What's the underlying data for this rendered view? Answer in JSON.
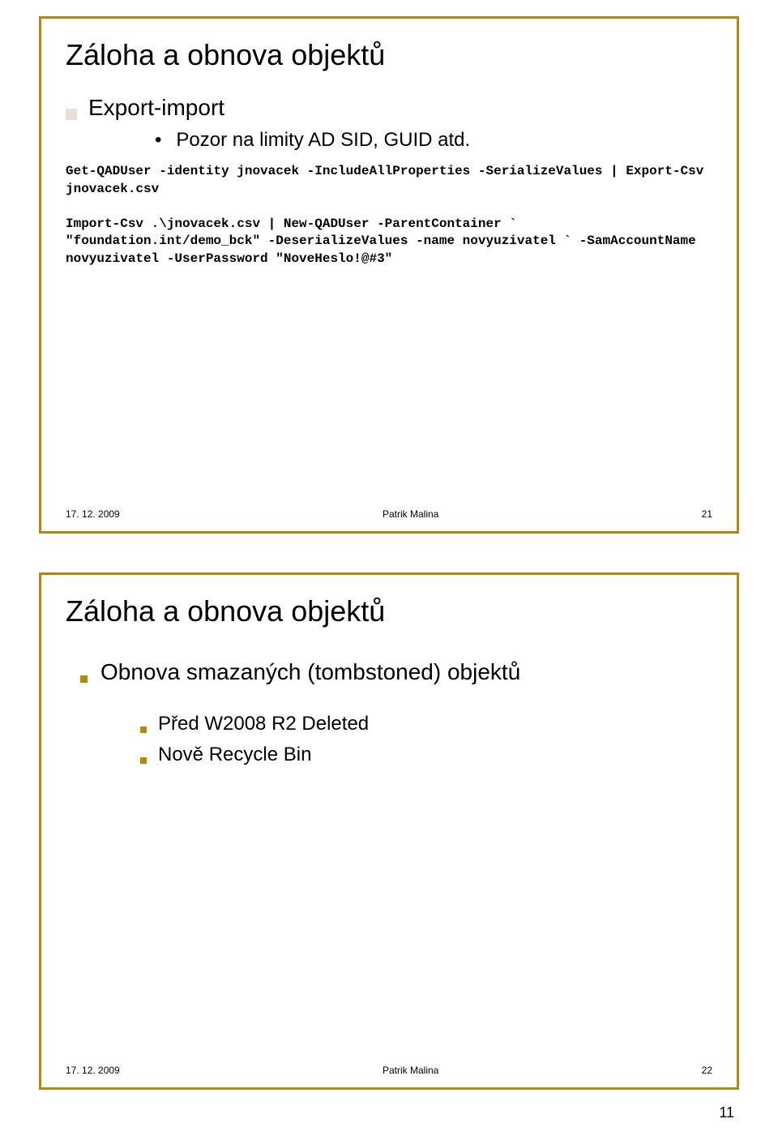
{
  "slide1": {
    "title": "Záloha a obnova objektů",
    "bullet": "Export-import",
    "subbullet": "Pozor na limity AD SID, GUID atd.",
    "code": "Get-QADUser -identity jnovacek -IncludeAllProperties -SerializeValues | Export-Csv jnovacek.csv\n\nImport-Csv .\\jnovacek.csv | New-QADUser -ParentContainer ` \"foundation.int/demo_bck\" -DeserializeValues -name novyuzivatel ` -SamAccountName novyuzivatel -UserPassword \"NoveHeslo!@#3\"",
    "footer_date": "17. 12. 2009",
    "footer_author": "Patrik Malina",
    "footer_num": "21"
  },
  "slide2": {
    "title": "Záloha a obnova objektů",
    "bullet": "Obnova smazaných (tombstoned) objektů",
    "sub1": "Před W2008 R2 Deleted",
    "sub2": "Nově Recycle Bin",
    "footer_date": "17. 12. 2009",
    "footer_author": "Patrik Malina",
    "footer_num": "22"
  },
  "page_number": "11"
}
